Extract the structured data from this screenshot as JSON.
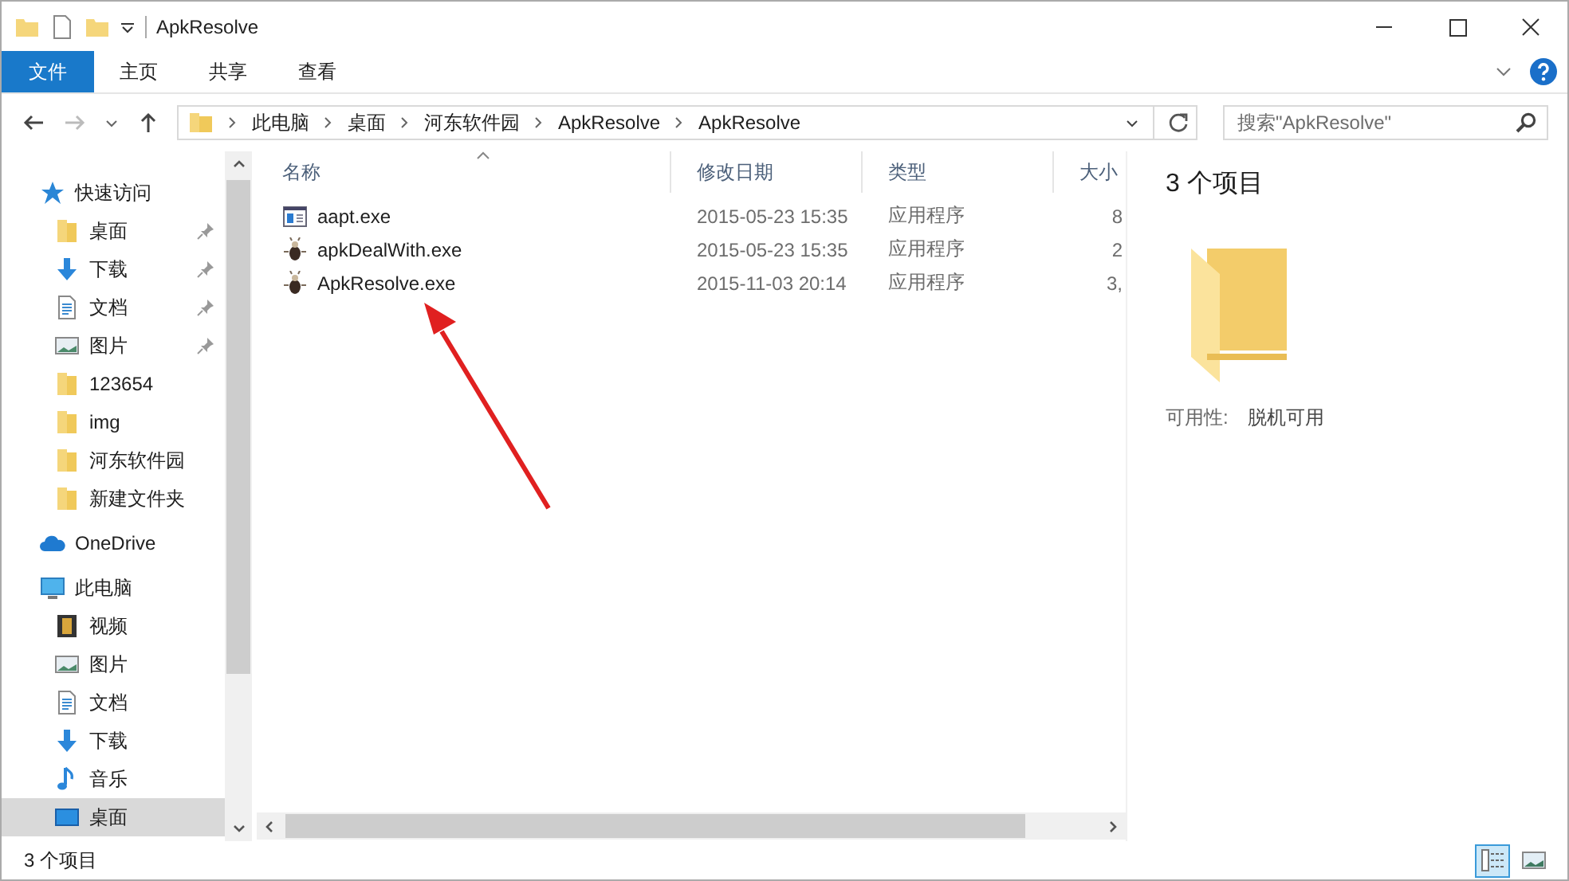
{
  "window": {
    "title": "ApkResolve"
  },
  "ribbon": {
    "tabs": [
      {
        "label": "文件",
        "selected": true
      },
      {
        "label": "主页",
        "selected": false
      },
      {
        "label": "共享",
        "selected": false
      },
      {
        "label": "查看",
        "selected": false
      }
    ]
  },
  "address": {
    "crumbs": [
      "此电脑",
      "桌面",
      "河东软件园",
      "ApkResolve",
      "ApkResolve"
    ]
  },
  "search": {
    "placeholder": "搜索\"ApkResolve\""
  },
  "sidebar": {
    "items": [
      {
        "label": "快速访问",
        "kind": "star",
        "selected": false,
        "children": [
          {
            "label": "桌面",
            "kind": "folder",
            "pinned": true,
            "selected": false
          },
          {
            "label": "下载",
            "kind": "download",
            "pinned": true,
            "selected": false
          },
          {
            "label": "文档",
            "kind": "document",
            "pinned": true,
            "selected": false
          },
          {
            "label": "图片",
            "kind": "picture",
            "pinned": true,
            "selected": false
          },
          {
            "label": "123654",
            "kind": "folder",
            "pinned": false,
            "selected": false
          },
          {
            "label": "img",
            "kind": "folder",
            "pinned": false,
            "selected": false
          },
          {
            "label": "河东软件园",
            "kind": "folder",
            "pinned": false,
            "selected": false
          },
          {
            "label": "新建文件夹",
            "kind": "folder",
            "pinned": false,
            "selected": false
          }
        ]
      },
      {
        "label": "OneDrive",
        "kind": "cloud",
        "selected": false
      },
      {
        "label": "此电脑",
        "kind": "computer",
        "selected": false,
        "children": [
          {
            "label": "视频",
            "kind": "video",
            "pinned": false,
            "selected": false
          },
          {
            "label": "图片",
            "kind": "picture",
            "pinned": false,
            "selected": false
          },
          {
            "label": "文档",
            "kind": "document",
            "pinned": false,
            "selected": false
          },
          {
            "label": "下载",
            "kind": "download",
            "pinned": false,
            "selected": false
          },
          {
            "label": "音乐",
            "kind": "music",
            "pinned": false,
            "selected": false
          },
          {
            "label": "桌面",
            "kind": "desktop",
            "pinned": false,
            "selected": true
          }
        ]
      }
    ]
  },
  "table": {
    "columns": [
      "名称",
      "修改日期",
      "类型",
      "大小"
    ],
    "rows": [
      {
        "name": "aapt.exe",
        "kind": "window",
        "modified": "2015-05-23 15:35",
        "type": "应用程序",
        "size": "8"
      },
      {
        "name": "apkDealWith.exe",
        "kind": "bug",
        "modified": "2015-05-23 15:35",
        "type": "应用程序",
        "size": "2"
      },
      {
        "name": "ApkResolve.exe",
        "kind": "bug",
        "modified": "2015-11-03 20:14",
        "type": "应用程序",
        "size": "3,"
      }
    ]
  },
  "details": {
    "title": "3 个项目",
    "availability_label": "可用性:",
    "availability_value": "脱机可用"
  },
  "status_bar": {
    "text": "3 个项目"
  },
  "view_buttons": [
    {
      "kind": "details",
      "selected": true
    },
    {
      "kind": "thumbnails",
      "selected": false
    }
  ]
}
